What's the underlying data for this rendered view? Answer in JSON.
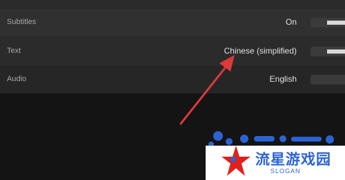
{
  "settings": {
    "rows": [
      {
        "label": "Subtitles",
        "value": "On"
      },
      {
        "label": "Text",
        "value": "Chinese (simplified)"
      },
      {
        "label": "Audio",
        "value": "English"
      }
    ]
  },
  "watermark": {
    "name": "流星游戏园",
    "slogan": "SLOGAN",
    "brand_color": "#2b63d4",
    "star_color": "#e0201c"
  },
  "annotation": {
    "arrow_color": "#e0393b"
  }
}
